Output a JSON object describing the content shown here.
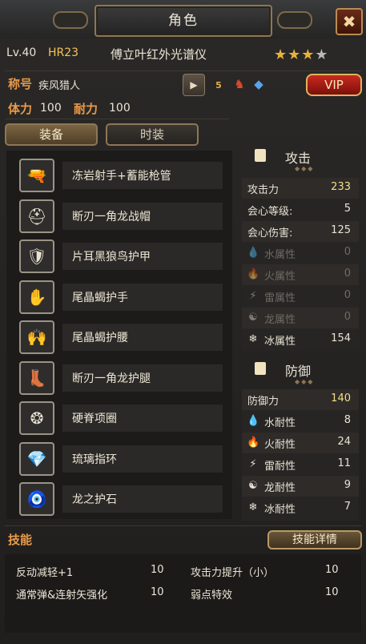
{
  "window": {
    "title": "角色",
    "close_icon": "✖"
  },
  "player": {
    "level": "Lv.40",
    "hr": "HR23",
    "name": "傅立叶红外光谱仪",
    "stars_filled": 3,
    "stars_total": 4,
    "title_label": "称号",
    "title_value": "疾风猎人",
    "badge_5": "5",
    "vip_label": "VIP",
    "stamina_label": "体力",
    "stamina_value": "100",
    "endurance_label": "耐力",
    "endurance_value": "100"
  },
  "tabs": {
    "equip": "装备",
    "fashion": "时装"
  },
  "equipment": [
    {
      "name": "冻岩射手+蓄能枪管",
      "icon": "gun-icon",
      "glyph": "🔫"
    },
    {
      "name": "断刃一角龙战帽",
      "icon": "helmet-icon",
      "glyph": "⛑"
    },
    {
      "name": "片耳黑狼鸟护甲",
      "icon": "armor-icon",
      "glyph": "🛡"
    },
    {
      "name": "尾晶蝎护手",
      "icon": "gauntlet-icon",
      "glyph": "✋"
    },
    {
      "name": "尾晶蝎护腰",
      "icon": "waist-icon",
      "glyph": "🙌"
    },
    {
      "name": "断刃一角龙护腿",
      "icon": "boots-icon",
      "glyph": "👢"
    },
    {
      "name": "硬脊项圈",
      "icon": "necklace-icon",
      "glyph": "❂"
    },
    {
      "name": "琉璃指环",
      "icon": "ring-icon",
      "glyph": "💎"
    },
    {
      "name": "龙之护石",
      "icon": "charm-icon",
      "glyph": "🧿"
    }
  ],
  "attack": {
    "title": "攻击",
    "rows": [
      {
        "name": "攻击力",
        "value": "233",
        "icon": "",
        "highlight": true,
        "dim": false
      },
      {
        "name": "会心等级:",
        "value": "5",
        "icon": "",
        "highlight": false,
        "dim": false
      },
      {
        "name": "会心伤害:",
        "value": "125",
        "icon": "",
        "highlight": false,
        "dim": false
      },
      {
        "name": "水属性",
        "value": "0",
        "icon": "water-icon",
        "glyph": "💧",
        "highlight": false,
        "dim": true
      },
      {
        "name": "火属性",
        "value": "0",
        "icon": "fire-icon",
        "glyph": "🔥",
        "highlight": false,
        "dim": true
      },
      {
        "name": "雷属性",
        "value": "0",
        "icon": "thunder-icon",
        "glyph": "⚡",
        "highlight": false,
        "dim": true
      },
      {
        "name": "龙属性",
        "value": "0",
        "icon": "dragon-icon",
        "glyph": "☯",
        "highlight": false,
        "dim": true
      },
      {
        "name": "冰属性",
        "value": "154",
        "icon": "ice-icon",
        "glyph": "❄",
        "highlight": false,
        "dim": false
      }
    ]
  },
  "defense": {
    "title": "防御",
    "rows": [
      {
        "name": "防御力",
        "value": "140",
        "icon": "",
        "highlight": true
      },
      {
        "name": "水耐性",
        "value": "8",
        "icon": "water-icon",
        "glyph": "💧"
      },
      {
        "name": "火耐性",
        "value": "24",
        "icon": "fire-icon",
        "glyph": "🔥"
      },
      {
        "name": "雷耐性",
        "value": "11",
        "icon": "thunder-icon",
        "glyph": "⚡"
      },
      {
        "name": "龙耐性",
        "value": "9",
        "icon": "dragon-icon",
        "glyph": "☯"
      },
      {
        "name": "冰耐性",
        "value": "7",
        "icon": "ice-icon",
        "glyph": "❄"
      }
    ]
  },
  "skills": {
    "label": "技能",
    "details_button": "技能详情",
    "list": [
      {
        "name": "反动减轻+1",
        "level": "10"
      },
      {
        "name": "攻击力提升（小）",
        "level": "10"
      },
      {
        "name": "通常弹&连射矢强化",
        "level": "10"
      },
      {
        "name": "弱点特效",
        "level": "10"
      }
    ]
  },
  "colors": {
    "accent_orange": "#e89a4a",
    "gold": "#f2c45a",
    "highlight_value": "#f3df8c",
    "dim_text": "#6e6a64"
  }
}
